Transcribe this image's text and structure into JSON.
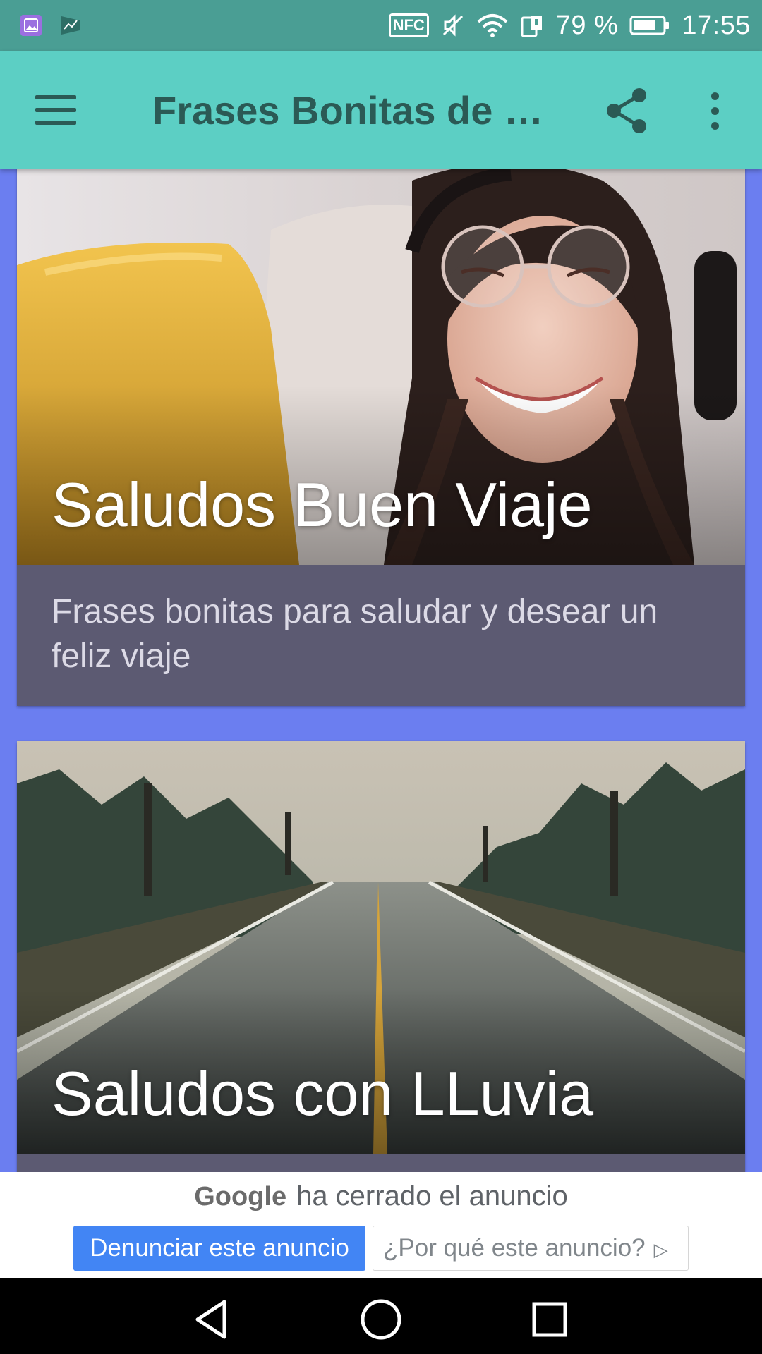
{
  "status_bar": {
    "battery_percent": "79 %",
    "time": "17:55",
    "nfc_label": "NFC",
    "icons": [
      "gallery-icon",
      "stats-icon",
      "nfc-icon",
      "mute-icon",
      "wifi-icon",
      "data-icon",
      "battery-icon"
    ]
  },
  "app_bar": {
    "title": "Frases Bonitas de S...",
    "icons": [
      "menu-icon",
      "share-icon",
      "more-vert-icon"
    ]
  },
  "cards": [
    {
      "title": "Saludos Buen Viaje",
      "description": "Frases bonitas para saludar y desear un feliz viaje",
      "image": "woman-with-headphones-photo"
    },
    {
      "title": "Saludos con LLuvia",
      "image": "rainy-road-photo"
    }
  ],
  "ad": {
    "brand": "Google",
    "closed_text": "ha cerrado el anuncio",
    "report_label": "Denunciar este anuncio",
    "why_label": "¿Por qué este anuncio?"
  },
  "colors": {
    "status_bar": "#4a9e94",
    "app_bar": "#5ccfc4",
    "background": "#6b7ef0",
    "card_footer": "#5c5a72",
    "ad_button": "#4285f4"
  }
}
